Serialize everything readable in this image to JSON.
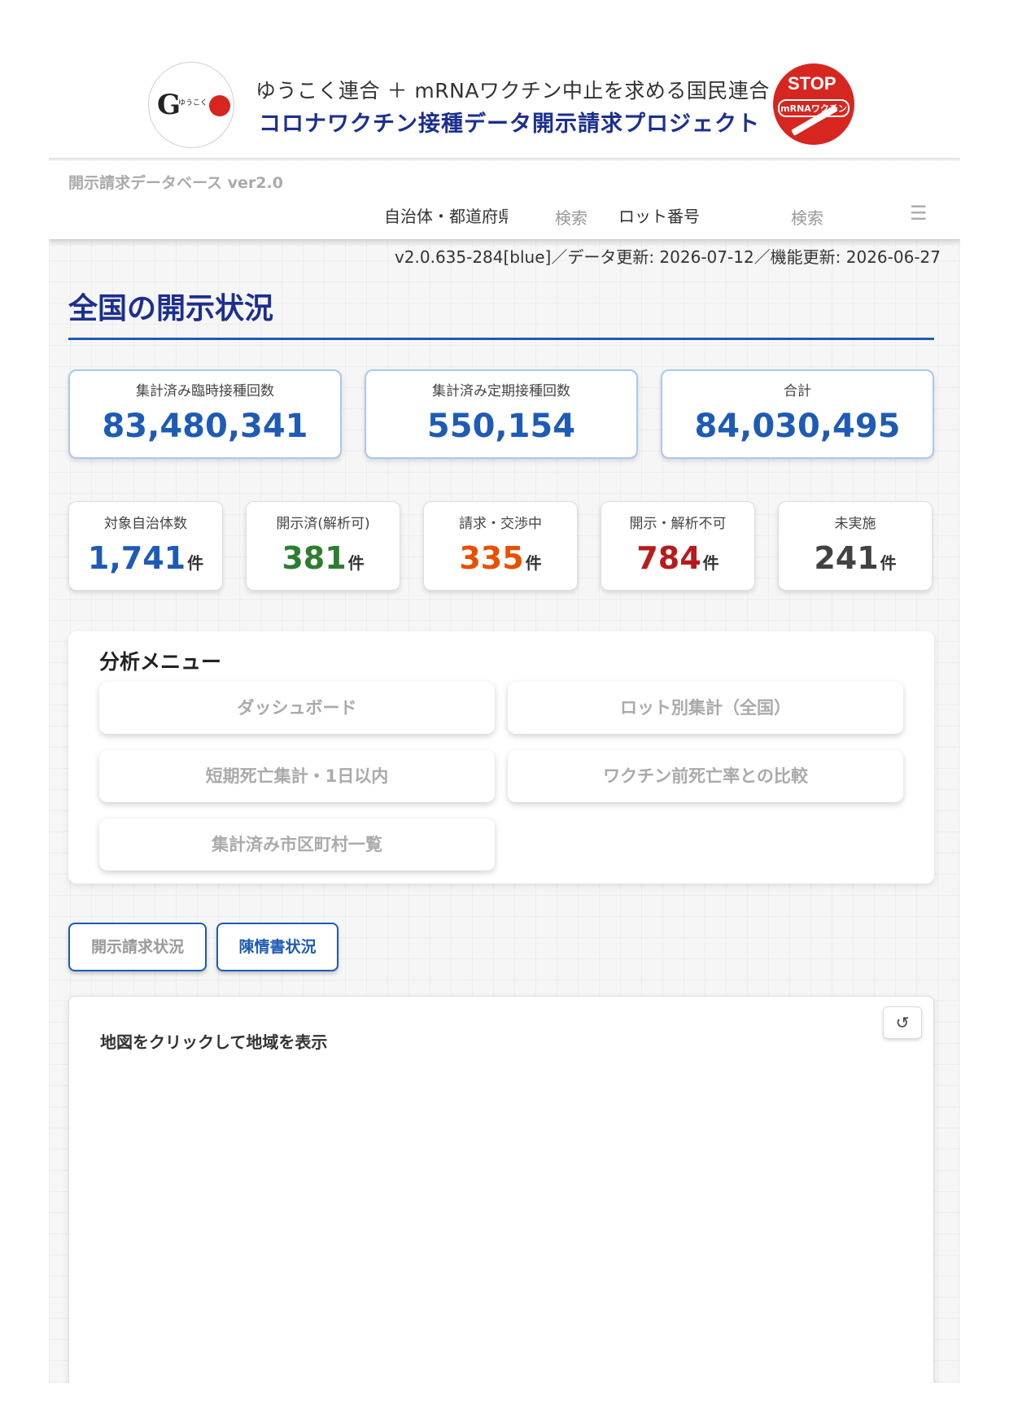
{
  "header": {
    "logo_glyph": "G",
    "logo_text": "ゆうこく",
    "line1": "ゆうこく連合 ＋ mRNAワクチン中止を求める国民連合",
    "line2": "コロナワクチン接種データ開示請求プロジェクト",
    "stop_badge": {
      "top": "STOP",
      "sub": "mRNAワクチン"
    }
  },
  "nav": {
    "db_title": "開示請求データベース ver2.0",
    "municipality_field": "自治体・都道府県",
    "search1": "検索",
    "lot_field": "ロット番号",
    "search2": "検索",
    "menu_icon": "☰"
  },
  "version_line": "v2.0.635-284[blue]／データ更新: 2026-07-12／機能更新: 2026-06-27",
  "page_title": "全国の開示状況",
  "totals": [
    {
      "label": "集計済み臨時接種回数",
      "value": "83,480,341"
    },
    {
      "label": "集計済み定期接種回数",
      "value": "550,154"
    },
    {
      "label": "合計",
      "value": "84,030,495"
    }
  ],
  "stats": [
    {
      "label": "対象自治体数",
      "value": "1,741",
      "unit": "件",
      "color": "#1e5bb5"
    },
    {
      "label": "開示済(解析可)",
      "value": "381",
      "unit": "件",
      "color": "#2e7d32"
    },
    {
      "label": "請求・交渉中",
      "value": "335",
      "unit": "件",
      "color": "#e65100"
    },
    {
      "label": "開示・解析不可",
      "value": "784",
      "unit": "件",
      "color": "#b71c1c"
    },
    {
      "label": "未実施",
      "value": "241",
      "unit": "件",
      "color": "#424242"
    }
  ],
  "analysis_menu": {
    "title": "分析メニュー",
    "buttons": [
      "ダッシュボード",
      "ロット別集計（全国）",
      "短期死亡集計・1日以内",
      "ワクチン前死亡率との比較",
      "集計済み市区町村一覧"
    ]
  },
  "tabs": [
    {
      "label": "開示請求状況",
      "active": false
    },
    {
      "label": "陳情書状況",
      "active": true
    }
  ],
  "map": {
    "hint": "地図をクリックして地域を表示",
    "reset_icon": "↺"
  }
}
